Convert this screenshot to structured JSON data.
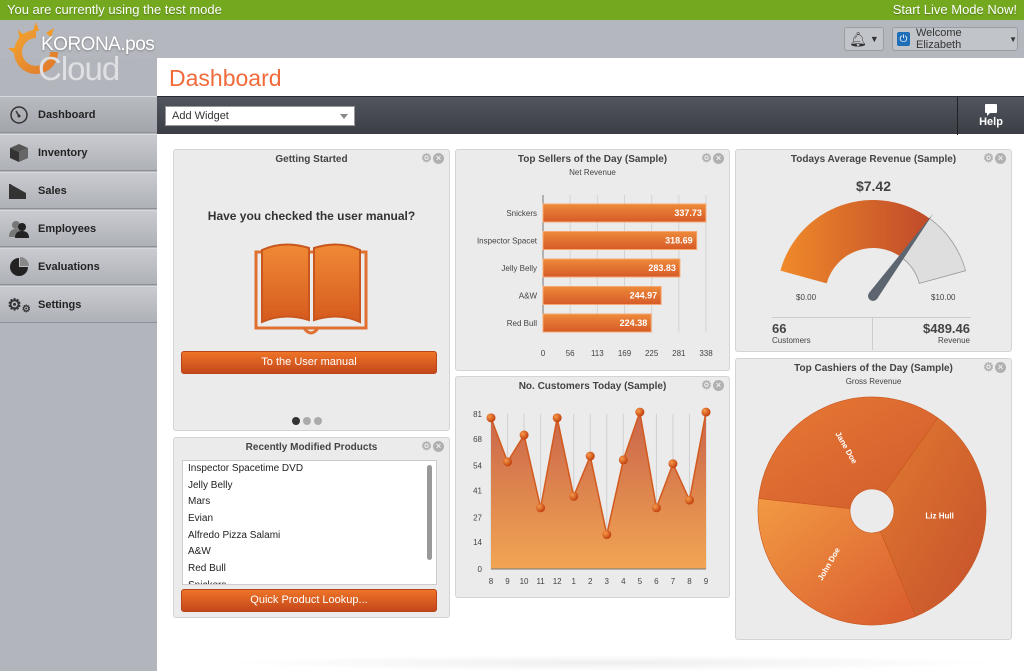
{
  "banner": {
    "left_text": "You are currently using the test mode",
    "right_link": "Start Live Mode Now!"
  },
  "logo": {
    "brand": "KORONA.pos",
    "product": "Cloud"
  },
  "header": {
    "notifications_icon": "bell-icon",
    "user_menu_label": "Welcome Elizabeth"
  },
  "page_title": "Dashboard",
  "toolbar": {
    "add_widget_placeholder": "Add Widget",
    "help_label": "Help"
  },
  "sidebar": {
    "items": [
      {
        "label": "Dashboard",
        "icon": "dashboard-gauge-icon",
        "active": true
      },
      {
        "label": "Inventory",
        "icon": "box-icon"
      },
      {
        "label": "Sales",
        "icon": "sales-icon"
      },
      {
        "label": "Employees",
        "icon": "people-icon"
      },
      {
        "label": "Evaluations",
        "icon": "pie-chart-icon"
      },
      {
        "label": "Settings",
        "icon": "gears-icon"
      }
    ]
  },
  "widgets": {
    "getting_started": {
      "title": "Getting Started",
      "question": "Have you checked the user manual?",
      "button": "To the User manual",
      "pages": 3,
      "current_page": 1
    },
    "recent_products": {
      "title": "Recently Modified Products",
      "items": [
        "Inspector Spacetime DVD",
        "Jelly Belly",
        "Mars",
        "Evian",
        "Alfredo Pizza Salami",
        "A&W",
        "Red Bull",
        "Snickers"
      ],
      "button": "Quick Product Lookup..."
    },
    "top_sellers": {
      "title": "Top Sellers of the Day (Sample)",
      "subtitle": "Net Revenue"
    },
    "customers": {
      "title": "No. Customers Today (Sample)"
    },
    "avg_revenue": {
      "title": "Todays Average Revenue (Sample)",
      "value": "$7.42",
      "min_label": "$0.00",
      "max_label": "$10.00",
      "customers_value": "66",
      "customers_label": "Customers",
      "revenue_value": "$489.46",
      "revenue_label": "Revenue"
    },
    "top_cashiers": {
      "title": "Top Cashiers of the Day (Sample)",
      "subtitle": "Gross Revenue"
    }
  },
  "chart_data": [
    {
      "type": "bar",
      "orientation": "horizontal",
      "title": "Top Sellers of the Day (Sample)",
      "subtitle": "Net Revenue",
      "categories": [
        "Snickers",
        "Inspector Spacet",
        "Jelly Belly",
        "A&W",
        "Red Bull"
      ],
      "values": [
        337.73,
        318.69,
        283.83,
        244.97,
        224.38
      ],
      "value_labels": [
        "337.73",
        "318.69",
        "283.83",
        "244.97",
        "224.38"
      ],
      "xticks": [
        "0",
        "56",
        "113",
        "169",
        "225",
        "281",
        "338"
      ],
      "xlim": [
        0,
        338
      ],
      "grid": true
    },
    {
      "type": "area",
      "title": "No. Customers Today (Sample)",
      "x": [
        "8",
        "9",
        "10",
        "11",
        "12",
        "1",
        "2",
        "3",
        "4",
        "5",
        "6",
        "7",
        "8",
        "9"
      ],
      "values": [
        79,
        56,
        70,
        32,
        79,
        38,
        59,
        18,
        57,
        82,
        32,
        55,
        36,
        82
      ],
      "yticks": [
        "0",
        "14",
        "27",
        "41",
        "54",
        "68",
        "81"
      ],
      "ylim": [
        0,
        81
      ],
      "grid": true
    },
    {
      "type": "gauge",
      "title": "Todays Average Revenue (Sample)",
      "value": 7.42,
      "range": [
        0,
        10
      ]
    },
    {
      "type": "pie",
      "title": "Top Cashiers of the Day (Sample)",
      "subtitle": "Gross Revenue",
      "labels": [
        "Liz Hull",
        "John Doe",
        "Jane Doe"
      ],
      "values": [
        34,
        33,
        33
      ],
      "donut": true
    }
  ]
}
